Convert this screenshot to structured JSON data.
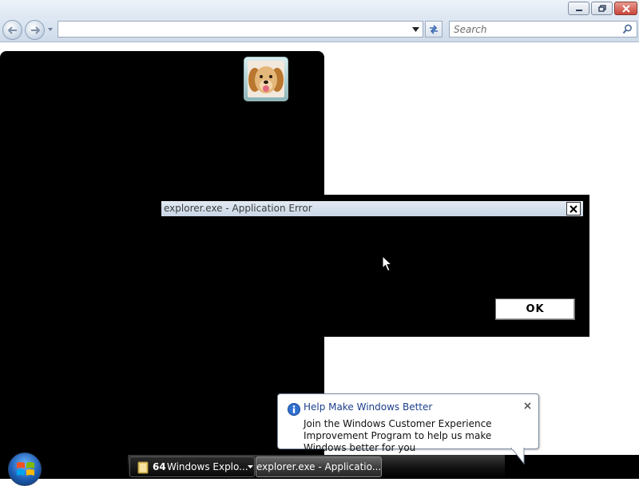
{
  "explorer": {
    "address_value": "",
    "search_placeholder": "Search"
  },
  "error_dialog": {
    "title": "explorer.exe - Application Error",
    "ok_label": "OK"
  },
  "balloon": {
    "title": "Help Make Windows Better",
    "body": "Join the Windows Customer Experience Improvement Program to help us make Windows better for you"
  },
  "taskbar": {
    "explorer_group_count": "64",
    "explorer_group_label": "Windows Explo...",
    "error_task_label": "explorer.exe - Applicatio..."
  },
  "icons": {
    "minimize": "minimize-icon",
    "maximize": "restore-icon",
    "close": "close-icon",
    "back": "back-arrow-icon",
    "forward": "forward-arrow-icon",
    "refresh": "refresh-icon",
    "search": "search-icon",
    "user": "user-picture-dog",
    "info": "info-icon",
    "start": "windows-logo-icon",
    "folder": "folder-icon"
  },
  "colors": {
    "balloon_title": "#1c3f8c",
    "close_button": "#c8443a",
    "chrome": "#dfe8f3"
  }
}
